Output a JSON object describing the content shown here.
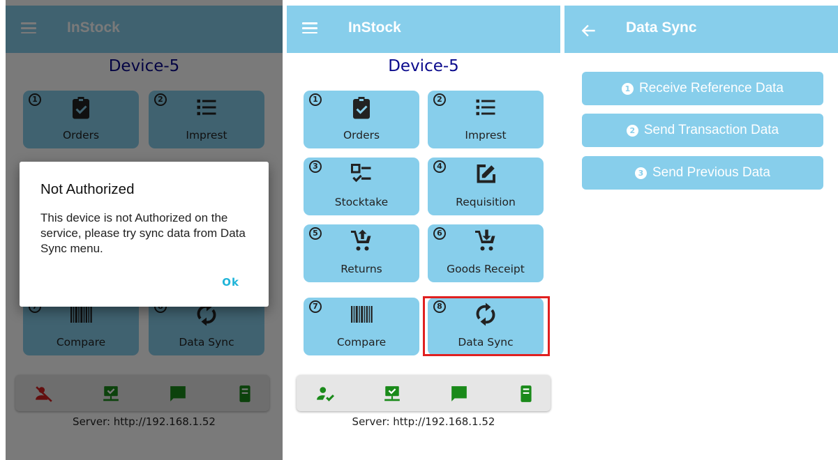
{
  "app": {
    "title": "InStock",
    "device": "Device-5",
    "server_text": "Server: http://192.168.1.52",
    "accent": "#87CEEB",
    "device_color": "#0a0a8c"
  },
  "tiles": [
    {
      "num": "1",
      "label": "Orders",
      "icon": "clipboard-check-icon"
    },
    {
      "num": "2",
      "label": "Imprest",
      "icon": "list-icon"
    },
    {
      "num": "3",
      "label": "Stocktake",
      "icon": "checklist-icon"
    },
    {
      "num": "4",
      "label": "Requisition",
      "icon": "edit-icon"
    },
    {
      "num": "5",
      "label": "Returns",
      "icon": "cart-upload-icon"
    },
    {
      "num": "6",
      "label": "Goods Receipt",
      "icon": "cart-download-icon"
    },
    {
      "num": "7",
      "label": "Compare",
      "icon": "barcode-icon"
    },
    {
      "num": "8",
      "label": "Data Sync",
      "icon": "sync-icon"
    }
  ],
  "status_icons": {
    "screen1": [
      "user-blocked-icon",
      "network-icon",
      "message-icon",
      "server-icon"
    ],
    "screen2": [
      "user-check-icon",
      "network-icon",
      "message-icon",
      "server-icon"
    ]
  },
  "dialog": {
    "title": "Not Authorized",
    "message": "This device is not Authorized on the service, please try sync data from Data Sync menu.",
    "ok_label": "Ok"
  },
  "data_sync": {
    "title": "Data Sync",
    "buttons": [
      {
        "num": "1",
        "label": "Receive Reference Data"
      },
      {
        "num": "2",
        "label": "Send Transaction Data"
      },
      {
        "num": "3",
        "label": "Send Previous Data"
      }
    ]
  }
}
